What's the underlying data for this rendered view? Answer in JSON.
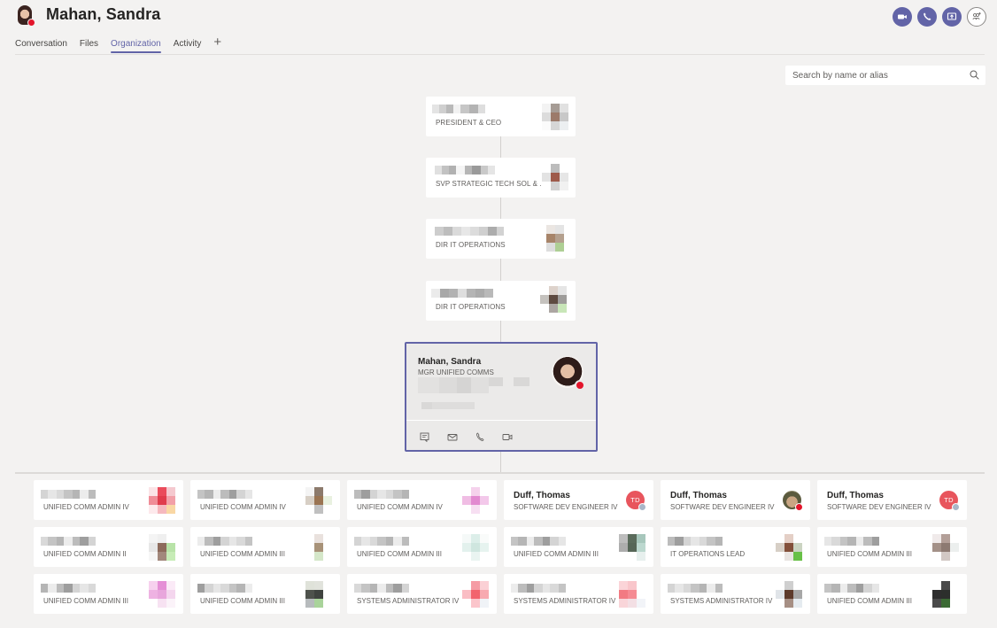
{
  "header": {
    "title": "Mahan, Sandra",
    "presence_color": "#e3152b",
    "actions": [
      {
        "name": "video-call-button",
        "icon": "video-icon"
      },
      {
        "name": "audio-call-button",
        "icon": "phone-icon"
      },
      {
        "name": "share-screen-button",
        "icon": "share-screen-icon"
      },
      {
        "name": "add-people-button",
        "icon": "add-people-icon"
      }
    ]
  },
  "tabs": [
    {
      "label": "Conversation",
      "active": false
    },
    {
      "label": "Files",
      "active": false
    },
    {
      "label": "Organization",
      "active": true
    },
    {
      "label": "Activity",
      "active": false
    }
  ],
  "tab_add_label": "+",
  "search": {
    "placeholder": "Search by name or alias",
    "value": ""
  },
  "accent_color": "#6264a7",
  "chain": [
    {
      "name": "[redacted]",
      "title": "PRESIDENT & CEO"
    },
    {
      "name": "[redacted]",
      "title": "SVP STRATEGIC TECH SOL & ..."
    },
    {
      "name": "[redacted]",
      "title": "DIR IT OPERATIONS"
    },
    {
      "name": "[redacted]",
      "title": "DIR IT OPERATIONS"
    }
  ],
  "focus": {
    "name": "Mahan, Sandra",
    "title": "MGR UNIFIED COMMS",
    "details": "[redacted]",
    "presence": "busy",
    "actions": [
      "chat",
      "email",
      "call",
      "video"
    ]
  },
  "reports": [
    {
      "name": "[redacted]",
      "title": "UNIFIED COMM ADMIN IV",
      "avatar": "pixelated"
    },
    {
      "name": "[redacted]",
      "title": "UNIFIED COMM ADMIN IV",
      "avatar": "pixelated"
    },
    {
      "name": "[redacted]",
      "title": "UNIFIED COMM ADMIN IV",
      "avatar": "pixelated"
    },
    {
      "name": "Duff, Thomas",
      "title": "SOFTWARE DEV ENGINEER IV",
      "avatar": "initials",
      "initials": "TD",
      "presence": "offline"
    },
    {
      "name": "Duff, Thomas",
      "title": "SOFTWARE DEV ENGINEER IV",
      "avatar": "photo",
      "presence": "busy"
    },
    {
      "name": "Duff, Thomas",
      "title": "SOFTWARE DEV ENGINEER IV",
      "avatar": "initials",
      "initials": "TD",
      "presence": "offline"
    },
    {
      "name": "[redacted]",
      "title": "UNIFIED COMM ADMIN II",
      "avatar": "pixelated"
    },
    {
      "name": "[redacted]",
      "title": "UNIFIED COMM ADMIN III",
      "avatar": "pixelated"
    },
    {
      "name": "[redacted]",
      "title": "UNIFIED COMM ADMIN III",
      "avatar": "pixelated"
    },
    {
      "name": "[redacted]",
      "title": "UNIFIED COMM ADMIN III",
      "avatar": "pixelated"
    },
    {
      "name": "[redacted]",
      "title": "IT OPERATIONS LEAD",
      "avatar": "pixelated"
    },
    {
      "name": "[redacted]",
      "title": "UNIFIED COMM ADMIN III",
      "avatar": "pixelated"
    },
    {
      "name": "[redacted]",
      "title": "UNIFIED COMM ADMIN III",
      "avatar": "pixelated"
    },
    {
      "name": "[redacted]",
      "title": "UNIFIED COMM ADMIN III",
      "avatar": "pixelated"
    },
    {
      "name": "[redacted]",
      "title": "SYSTEMS ADMINISTRATOR IV",
      "avatar": "pixelated"
    },
    {
      "name": "[redacted]",
      "title": "SYSTEMS ADMINISTRATOR IV",
      "avatar": "pixelated"
    },
    {
      "name": "[redacted]",
      "title": "SYSTEMS ADMINISTRATOR IV",
      "avatar": "pixelated"
    },
    {
      "name": "[redacted]",
      "title": "UNIFIED COMM ADMIN III",
      "avatar": "pixelated"
    }
  ],
  "presence_colors": {
    "busy": "#e3152b",
    "offline": "#a9b6c8",
    "available": "#6bb700"
  },
  "initials_avatar_color": "#e8555d"
}
